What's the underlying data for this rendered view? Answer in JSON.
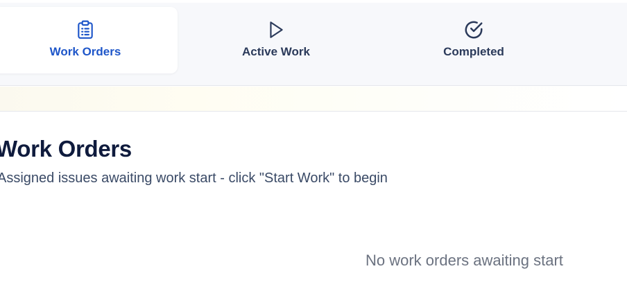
{
  "tabs": [
    {
      "label": "Work Orders",
      "icon": "clipboard-list-icon",
      "active": true
    },
    {
      "label": "Active Work",
      "icon": "play-icon",
      "active": false
    },
    {
      "label": "Completed",
      "icon": "check-circle-icon",
      "active": false
    }
  ],
  "main": {
    "title": "Work Orders",
    "subtitle": "Assigned issues awaiting work start - click \"Start Work\" to begin",
    "empty_message": "No work orders awaiting start"
  },
  "colors": {
    "accent": "#1e56c9",
    "tab_text": "#2b3a5a",
    "title": "#0f1b3d",
    "muted": "#6b7280"
  }
}
